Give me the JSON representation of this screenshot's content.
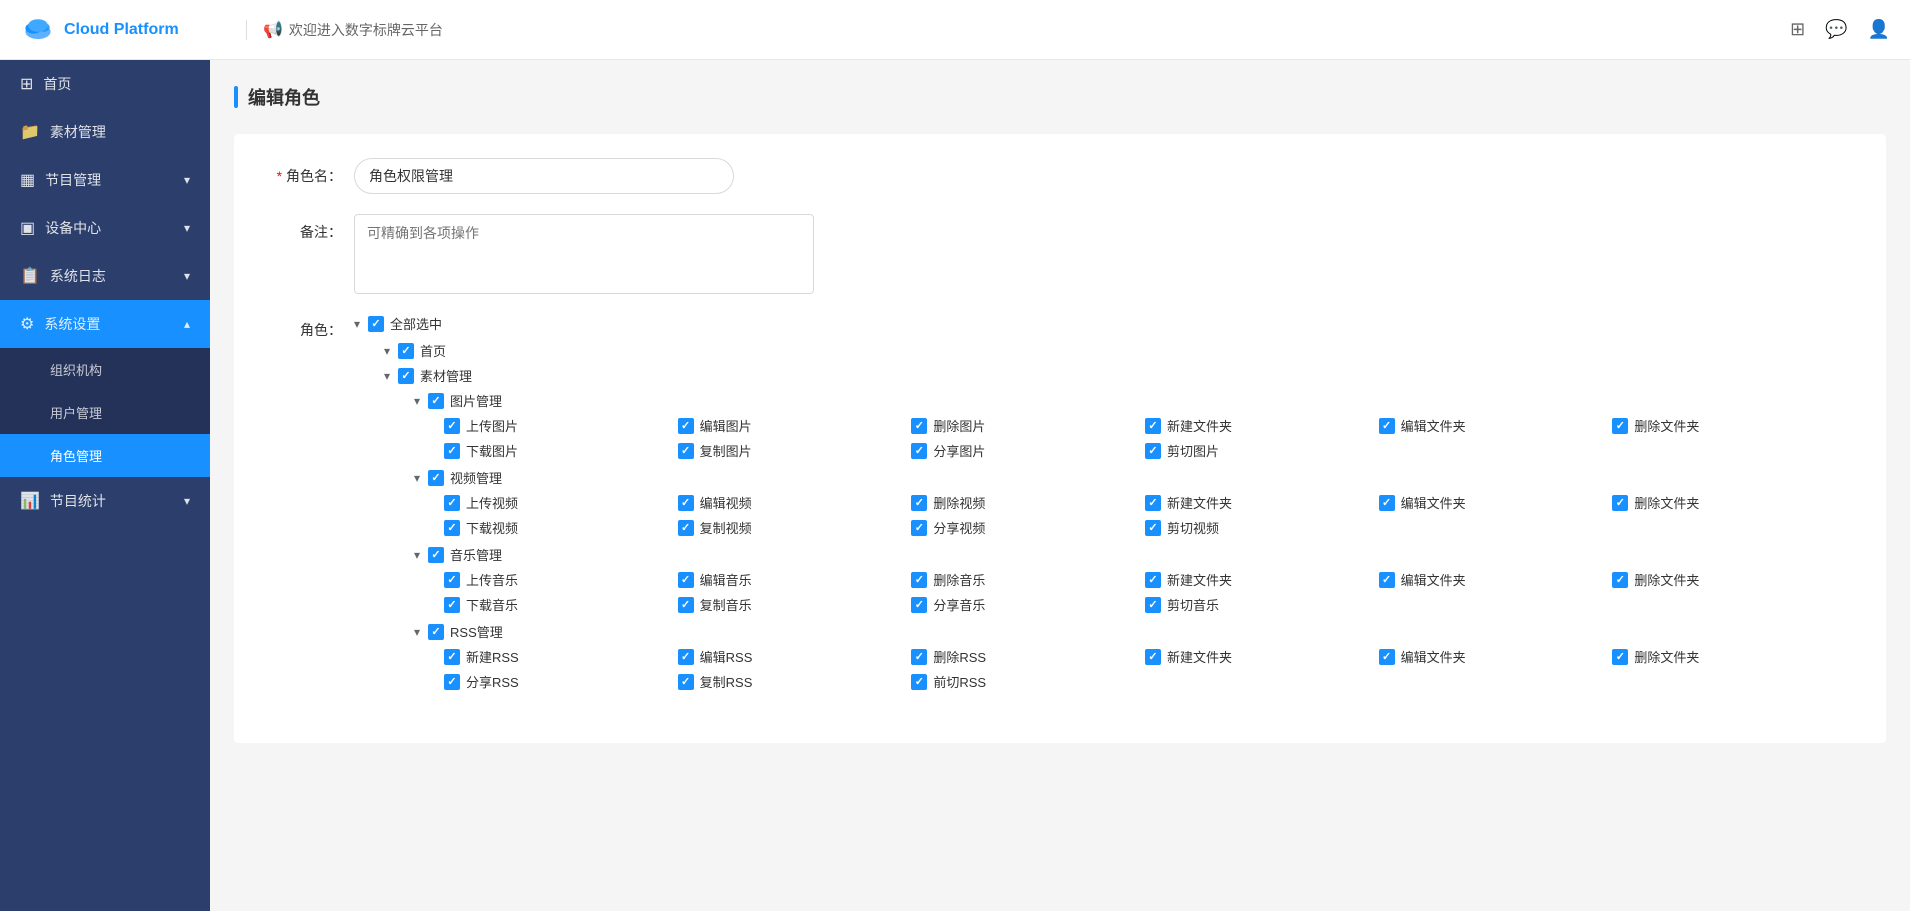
{
  "header": {
    "logo_text": "Cloud Platform",
    "welcome": "欢迎进入数字标牌云平台",
    "icons": [
      "grid-icon",
      "chat-icon",
      "user-icon"
    ]
  },
  "sidebar": {
    "items": [
      {
        "id": "home",
        "label": "首页",
        "icon": "⊞",
        "active": false,
        "expandable": false
      },
      {
        "id": "assets",
        "label": "素材管理",
        "icon": "📁",
        "active": false,
        "expandable": false
      },
      {
        "id": "programs",
        "label": "节目管理",
        "icon": "⊟",
        "active": false,
        "expandable": true
      },
      {
        "id": "devices",
        "label": "设备中心",
        "icon": "⊡",
        "active": false,
        "expandable": true
      },
      {
        "id": "logs",
        "label": "系统日志",
        "icon": "📋",
        "active": false,
        "expandable": true
      },
      {
        "id": "settings",
        "label": "系统设置",
        "icon": "⚙",
        "active": true,
        "expandable": true,
        "children": [
          {
            "id": "org",
            "label": "组织机构",
            "active": false
          },
          {
            "id": "users",
            "label": "用户管理",
            "active": false
          },
          {
            "id": "roles",
            "label": "角色管理",
            "active": true
          }
        ]
      },
      {
        "id": "stats",
        "label": "节目统计",
        "icon": "📊",
        "active": false,
        "expandable": true
      }
    ]
  },
  "page": {
    "title": "编辑角色",
    "form": {
      "role_name_label": "角色名：",
      "role_name_value": "角色权限管理",
      "remark_label": "备注：",
      "remark_placeholder": "可精确到各项操作",
      "role_label": "角色："
    }
  },
  "permissions": {
    "select_all_label": "全部选中",
    "modules": [
      {
        "label": "首页",
        "children": []
      },
      {
        "label": "素材管理",
        "children": [
          {
            "label": "图片管理",
            "perms": [
              [
                "上传图片",
                "编辑图片",
                "删除图片",
                "新建文件夹",
                "编辑文件夹",
                "删除文件夹"
              ],
              [
                "下载图片",
                "复制图片",
                "分享图片",
                "剪切图片",
                "",
                ""
              ]
            ]
          },
          {
            "label": "视频管理",
            "perms": [
              [
                "上传视频",
                "编辑视频",
                "删除视频",
                "新建文件夹",
                "编辑文件夹",
                "删除文件夹"
              ],
              [
                "下载视频",
                "复制视频",
                "分享视频",
                "剪切视频",
                "",
                ""
              ]
            ]
          },
          {
            "label": "音乐管理",
            "perms": [
              [
                "上传音乐",
                "编辑音乐",
                "删除音乐",
                "新建文件夹",
                "编辑文件夹",
                "删除文件夹"
              ],
              [
                "下载音乐",
                "复制音乐",
                "分享音乐",
                "剪切音乐",
                "",
                ""
              ]
            ]
          },
          {
            "label": "RSS管理",
            "perms": [
              [
                "新建RSS",
                "编辑RSS",
                "删除RSS",
                "新建文件夹",
                "编辑文件夹",
                "删除文件夹"
              ],
              [
                "分享RSS",
                "复制RSS",
                "前切RSS",
                "",
                "",
                ""
              ]
            ]
          }
        ]
      }
    ]
  }
}
